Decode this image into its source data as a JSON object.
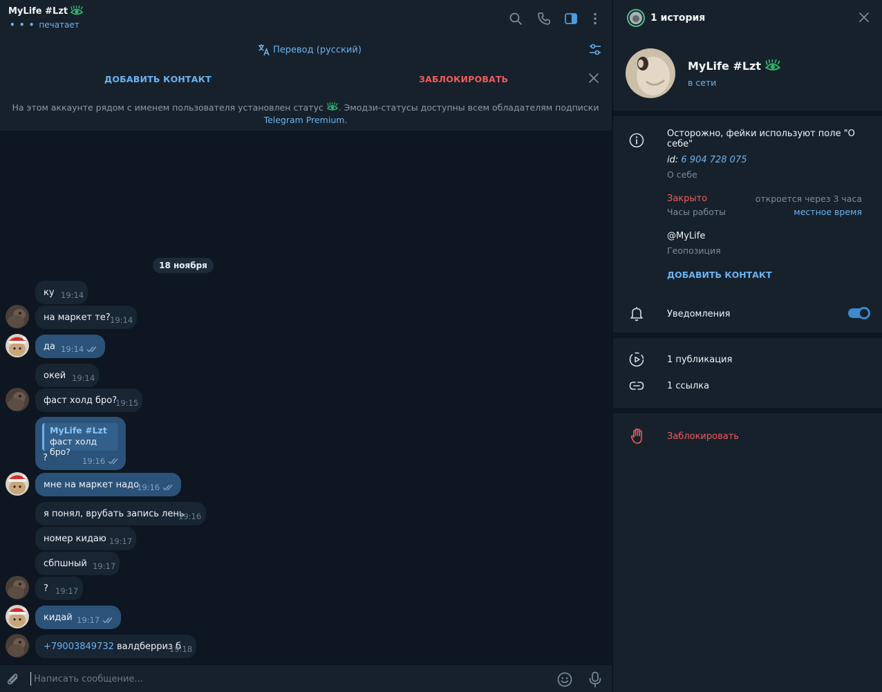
{
  "header": {
    "title": "MyLife #Lzt",
    "status": "печатает",
    "typing_dots": "• • •"
  },
  "translate": {
    "label": "Перевод (русский)"
  },
  "action_bar": {
    "add_contact": "ДОБАВИТЬ КОНТАКТ",
    "block": "ЗАБЛОКИРОВАТЬ"
  },
  "notice": {
    "part1": "На этом аккаунте рядом с именем пользователя установлен статус",
    "part2": ". Эмодзи-статусы доступны всем обладателям подписки",
    "link": "Telegram Premium",
    "end": "."
  },
  "date_chip": "18 ноября",
  "messages": [
    {
      "text": "ку",
      "time": "19:14",
      "out": false
    },
    {
      "text": "на маркет те?",
      "time": "19:14",
      "out": false
    },
    {
      "text": "да",
      "time": "19:14",
      "out": true
    },
    {
      "text": "окей",
      "time": "19:14",
      "out": false
    },
    {
      "text": "фаст холд бро?",
      "time": "19:15",
      "out": false
    },
    {
      "text": "?",
      "time": "19:16",
      "out": true,
      "reply_name": "MyLife #Lzt",
      "reply_text": "фаст холд бро?"
    },
    {
      "text": "мне на маркет надо",
      "time": "19:16",
      "out": true
    },
    {
      "text": "я понял, врубать запись лень",
      "time": "19:16",
      "out": false
    },
    {
      "text": "номер кидаю",
      "time": "19:17",
      "out": false
    },
    {
      "text": "сбпшный",
      "time": "19:17",
      "out": false
    },
    {
      "text": "?",
      "time": "19:17",
      "out": false
    },
    {
      "text": "кидай",
      "time": "19:17",
      "out": true
    },
    {
      "text": "валдберриз б",
      "phone": "+79003849732",
      "time": "19:18",
      "out": false
    }
  ],
  "composer": {
    "placeholder": "Написать сообщение..."
  },
  "profile": {
    "stories": "1 история",
    "name": "MyLife #Lzt",
    "status": "в сети",
    "warning": "Осторожно, фейки используют поле \"О себе\"",
    "id_label": "id:",
    "id_value": "6 904 728 075",
    "about_label": "О себе",
    "closed": "Закрыто",
    "opens_in": "откроется через 3 часа",
    "hours_label": "Часы работы",
    "local_time": "местное время",
    "username": "@MyLife",
    "geo_label": "Геопозиция",
    "add_contact": "ДОБАВИТЬ КОНТАКТ",
    "notifications": "Уведомления",
    "notifications_on": true,
    "publications": "1 публикация",
    "links": "1 ссылка",
    "block": "Заблокировать"
  },
  "colors": {
    "accent": "#6ab3f3",
    "danger": "#ef5b5b",
    "bg": "#0e1621",
    "panel": "#17212b",
    "bubble_in": "#182533",
    "bubble_out": "#2b5278",
    "status_emoji": "#2fb36a"
  },
  "icons": [
    "search-icon",
    "phone-icon",
    "sidebar-toggle-icon",
    "more-vertical-icon",
    "translate-icon",
    "filter-icon",
    "close-icon",
    "eye-emoji-icon",
    "attach-icon",
    "emoji-icon",
    "mic-icon",
    "info-icon",
    "bell-icon",
    "publication-icon",
    "link-icon",
    "hand-block-icon",
    "check-double-icon"
  ]
}
